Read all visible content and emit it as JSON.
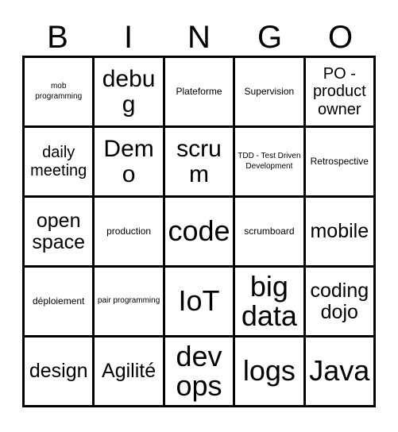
{
  "card": {
    "title": "BINGO",
    "headers": [
      "B",
      "I",
      "N",
      "G",
      "O"
    ],
    "colors": {
      "background": "#ffffff",
      "text": "#000000",
      "grid_line": "#000000"
    },
    "rows": [
      [
        {
          "label": "mob programming",
          "size": "xs"
        },
        {
          "label": "debug",
          "size": "xl"
        },
        {
          "label": "Plateforme",
          "size": "s"
        },
        {
          "label": "Supervision",
          "size": "s"
        },
        {
          "label": "PO - product owner",
          "size": "m"
        }
      ],
      [
        {
          "label": "daily meeting",
          "size": "m"
        },
        {
          "label": "Demo",
          "size": "xl"
        },
        {
          "label": "scrum",
          "size": "xl"
        },
        {
          "label": "TDD - Test Driven Development",
          "size": "xs"
        },
        {
          "label": "Retrospective",
          "size": "s"
        }
      ],
      [
        {
          "label": "open space",
          "size": "l"
        },
        {
          "label": "production",
          "size": "s"
        },
        {
          "label": "code",
          "size": "xxl"
        },
        {
          "label": "scrumboard",
          "size": "s"
        },
        {
          "label": "mobile",
          "size": "l"
        }
      ],
      [
        {
          "label": "déploiement",
          "size": "s"
        },
        {
          "label": "pair programming",
          "size": "xs"
        },
        {
          "label": "IoT",
          "size": "xxl"
        },
        {
          "label": "big data",
          "size": "xxl"
        },
        {
          "label": "coding dojo",
          "size": "l"
        }
      ],
      [
        {
          "label": "design",
          "size": "l"
        },
        {
          "label": "Agilité",
          "size": "l"
        },
        {
          "label": "dev ops",
          "size": "xxl"
        },
        {
          "label": "logs",
          "size": "xxl"
        },
        {
          "label": "Java",
          "size": "xxl"
        }
      ]
    ]
  }
}
